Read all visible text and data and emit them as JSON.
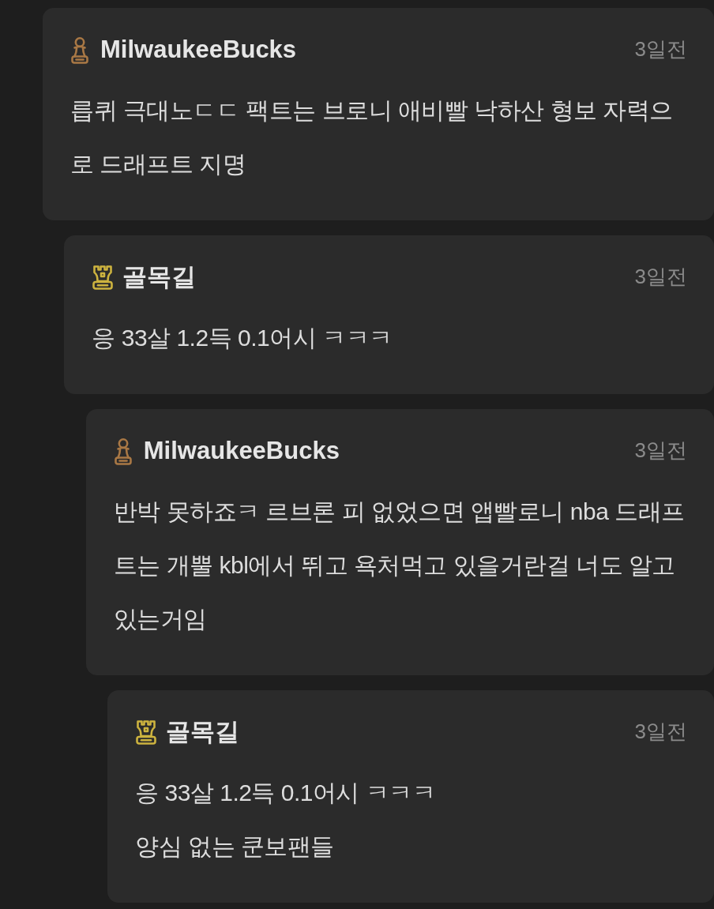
{
  "comments": [
    {
      "author": "MilwaukeeBucks",
      "badge": {
        "kind": "pawn",
        "color": "#a97845"
      },
      "time": "3일전",
      "text": "릅퀴 극대노ㄷㄷ 팩트는 브로니 애비빨 낙하산 형보 자력으로 드래프트 지명",
      "children": [
        {
          "author": "골목길",
          "badge": {
            "kind": "rook",
            "color": "#cdb33f"
          },
          "time": "3일전",
          "text": "응 33살 1.2득 0.1어시 ㅋㅋㅋ",
          "children": [
            {
              "author": "MilwaukeeBucks",
              "badge": {
                "kind": "pawn",
                "color": "#a97845"
              },
              "time": "3일전",
              "text": "반박 못하죠ㅋ 르브론 피 없었으면 앱빨로니 nba 드래프트는 개뿔 kbl에서 뛰고 욕처먹고 있을거란걸 너도 알고 있는거임",
              "children": [
                {
                  "author": "골목길",
                  "badge": {
                    "kind": "rook",
                    "color": "#cdb33f"
                  },
                  "time": "3일전",
                  "text": "응 33살 1.2득 0.1어시 ㅋㅋㅋ\n양심 없는 쿤보팬들"
                }
              ]
            }
          ]
        }
      ]
    }
  ]
}
